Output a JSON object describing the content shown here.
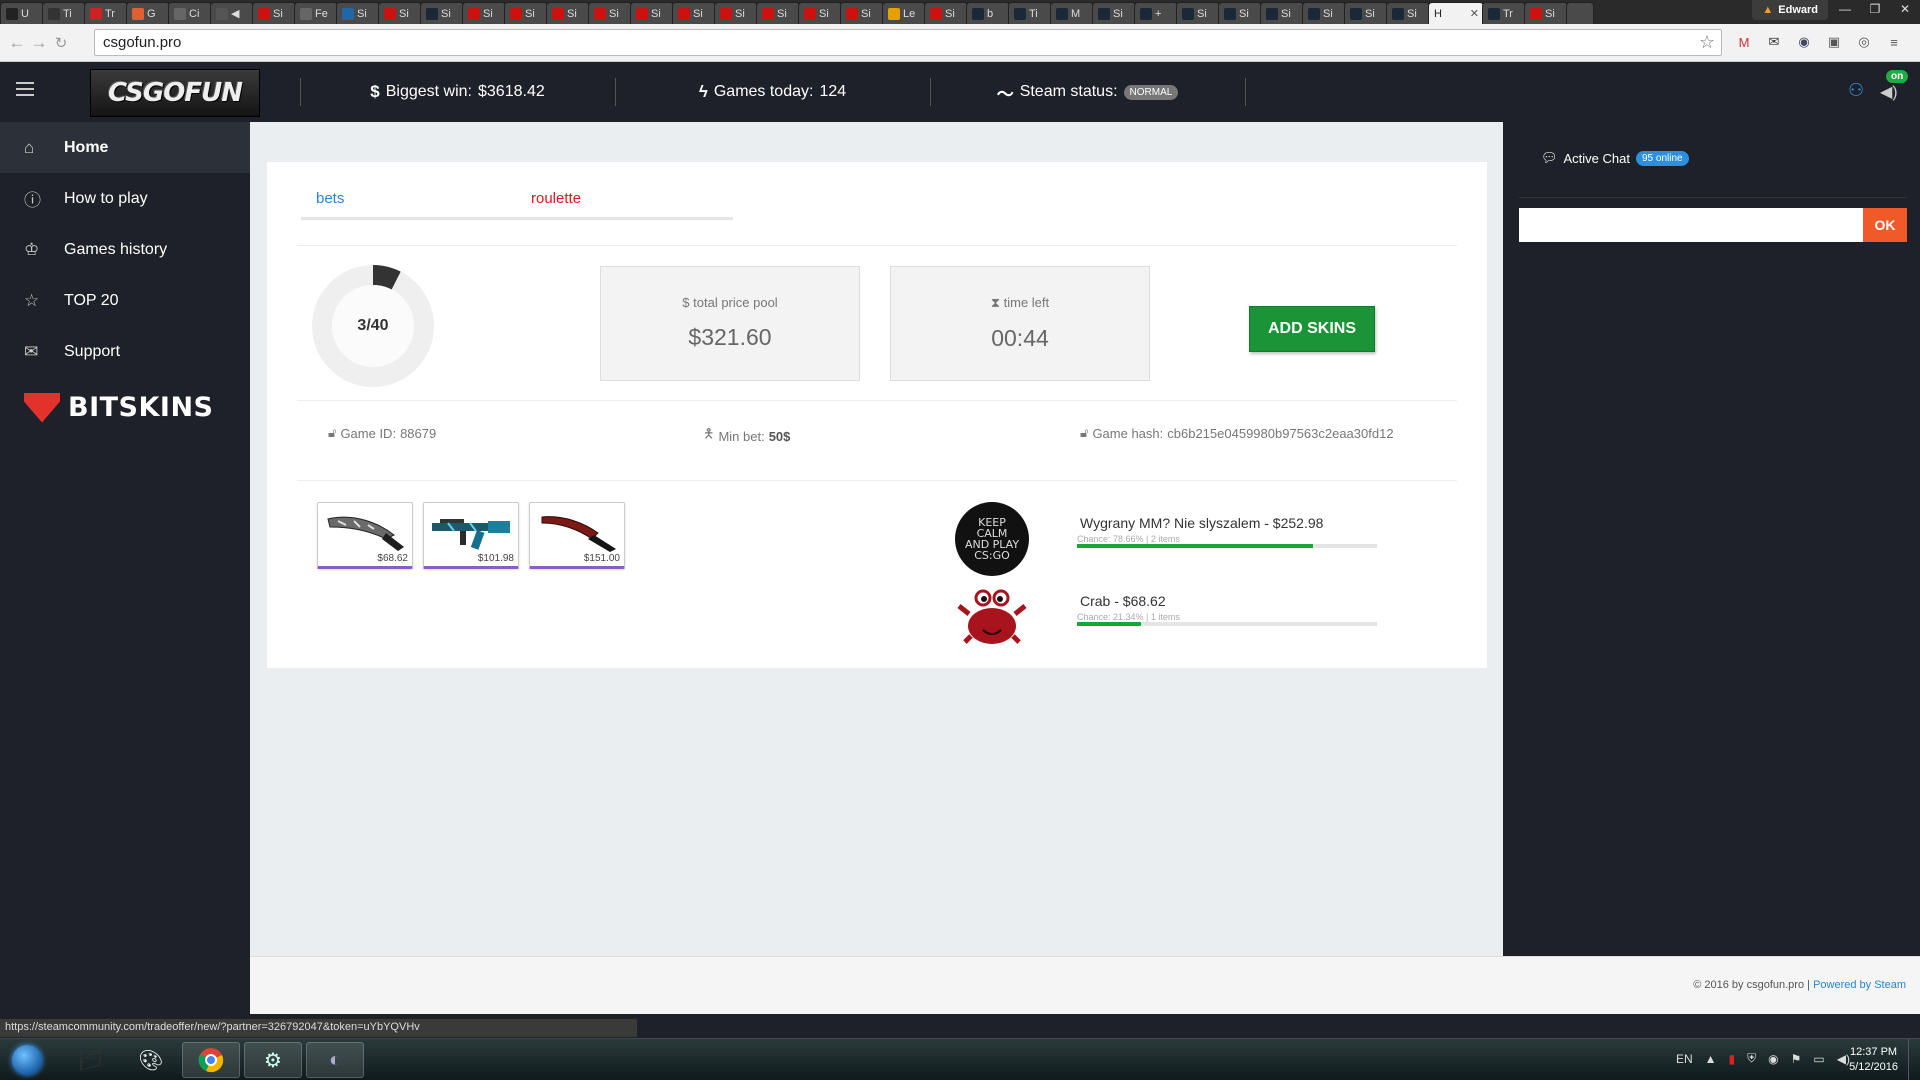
{
  "browser": {
    "tabs": [
      {
        "label": "U",
        "icon": "square-icon",
        "color": "#222"
      },
      {
        "label": "Ti",
        "icon": "circle-icon",
        "color": "#333"
      },
      {
        "label": "Tr",
        "icon": "youtube-icon",
        "color": "#cc2222"
      },
      {
        "label": "G",
        "icon": "g-icon",
        "color": "#e06030"
      },
      {
        "label": "Ci",
        "icon": "doc-icon",
        "color": "#666"
      },
      {
        "label": "◀",
        "icon": "audio-icon",
        "color": "#555"
      },
      {
        "label": "Si",
        "icon": "sr-icon",
        "color": "#cc1111"
      },
      {
        "label": "Fe",
        "icon": "doc-icon",
        "color": "#666"
      },
      {
        "label": "Si",
        "icon": "v-icon",
        "color": "#2266aa"
      },
      {
        "label": "Si",
        "icon": "sr-icon",
        "color": "#cc1111"
      },
      {
        "label": "Si",
        "icon": "steam-icon",
        "color": "#1b2838"
      },
      {
        "label": "Si",
        "icon": "sr-icon",
        "color": "#cc1111"
      },
      {
        "label": "Si",
        "icon": "sr-icon",
        "color": "#cc1111"
      },
      {
        "label": "Si",
        "icon": "sr-icon",
        "color": "#cc1111"
      },
      {
        "label": "Si",
        "icon": "sr-icon",
        "color": "#cc1111"
      },
      {
        "label": "Si",
        "icon": "sr-icon",
        "color": "#cc1111"
      },
      {
        "label": "Si",
        "icon": "sr-icon",
        "color": "#cc1111"
      },
      {
        "label": "Si",
        "icon": "sr-icon",
        "color": "#cc1111"
      },
      {
        "label": "Si",
        "icon": "sr-icon",
        "color": "#cc1111"
      },
      {
        "label": "Si",
        "icon": "sr-icon",
        "color": "#cc1111"
      },
      {
        "label": "Si",
        "icon": "sr-icon",
        "color": "#cc1111"
      },
      {
        "label": "Le",
        "icon": "coin-icon",
        "color": "#e8a000"
      },
      {
        "label": "Si",
        "icon": "sr-icon",
        "color": "#cc1111"
      },
      {
        "label": "b",
        "icon": "steam-icon",
        "color": "#1b2838"
      },
      {
        "label": "Ti",
        "icon": "steam-icon",
        "color": "#1b2838"
      },
      {
        "label": "M",
        "icon": "steam-icon",
        "color": "#1b2838"
      },
      {
        "label": "Si",
        "icon": "steam-icon",
        "color": "#1b2838"
      },
      {
        "label": "+",
        "icon": "steam-icon",
        "color": "#1b2838"
      },
      {
        "label": "Si",
        "icon": "steam-icon",
        "color": "#1b2838"
      },
      {
        "label": "Si",
        "icon": "steam-icon",
        "color": "#1b2838"
      },
      {
        "label": "Si",
        "icon": "steam-icon",
        "color": "#1b2838"
      },
      {
        "label": "Si",
        "icon": "steam-icon",
        "color": "#1b2838"
      },
      {
        "label": "Si",
        "icon": "steam-icon",
        "color": "#1b2838"
      },
      {
        "label": "Si",
        "icon": "steam-icon",
        "color": "#1b2838"
      }
    ],
    "active_tab": {
      "label": "H",
      "close": "✕"
    },
    "after_tabs": [
      {
        "label": "Tr",
        "icon": "steam-icon",
        "color": "#1b2838"
      },
      {
        "label": "Si",
        "icon": "sr-icon",
        "color": "#cc1111"
      }
    ],
    "user": "Edward",
    "window_controls": [
      "—",
      "❐",
      "✕"
    ],
    "url": "csgofun.pro",
    "status_url": "https://steamcommunity.com/tradeoffer/new/?partner=326792047&token=uYbYQVHv"
  },
  "header": {
    "logo": "CSGOFUN",
    "biggest_win_label": "Biggest win:",
    "biggest_win_value": "$3618.42",
    "games_today_label": "Games today:",
    "games_today_value": "124",
    "steam_status_label": "Steam status:",
    "steam_status_value": "NORMAL",
    "online_badge": "on"
  },
  "sidebar": {
    "items": [
      {
        "label": "Home",
        "icon": "home-icon",
        "glyph": "⌂"
      },
      {
        "label": "How to play",
        "icon": "info-icon",
        "glyph": "ⓘ"
      },
      {
        "label": "Games history",
        "icon": "trophy-icon",
        "glyph": "♔"
      },
      {
        "label": "TOP 20",
        "icon": "star-icon",
        "glyph": "☆"
      },
      {
        "label": "Support",
        "icon": "mail-icon",
        "glyph": "✉"
      }
    ],
    "sponsor": "BITSKINS"
  },
  "game": {
    "tabs": {
      "bets": "bets",
      "roulette": "roulette"
    },
    "items_count": "3/40",
    "items_fraction": 0.075,
    "total_pool_label": "total price pool",
    "total_pool_value": "$321.60",
    "time_left_label": "time left",
    "time_left_value": "00:44",
    "add_skins": "ADD SKINS",
    "game_id_label": "Game ID:",
    "game_id_value": "88679",
    "min_bet_label": "Min bet:",
    "min_bet_value": "50$",
    "game_hash_label": "Game hash:",
    "game_hash_value": "cb6b215e0459980b97563c2eaa30fd12",
    "skins": [
      {
        "price": "$68.62",
        "kind": "knife-camo"
      },
      {
        "price": "$101.98",
        "kind": "rifle-blue"
      },
      {
        "price": "$151.00",
        "kind": "knife-red"
      }
    ],
    "players": [
      {
        "name": "Wygrany MM? Nie slyszalem",
        "amount": "- $252.98",
        "chance_text": "Chance: 78.66% | 2 items",
        "chance": 0.7866,
        "avatar_text": "KEEP CALM AND PLAY CS:GO"
      },
      {
        "name": "Crab",
        "amount": "- $68.62",
        "chance_text": "Chance: 21.34% | 1 items",
        "chance": 0.2134
      }
    ]
  },
  "chat": {
    "title": "Active Chat",
    "online": "95 online",
    "input_value": "",
    "ok": "OK"
  },
  "footer": {
    "copyright": "© 2016 by csgofun.pro",
    "divider": "|",
    "powered": "Powered by Steam"
  },
  "taskbar": {
    "lang": "EN",
    "time": "12:37 PM",
    "date": "5/12/2016"
  },
  "colors": {
    "accent_blue": "#2a83d2",
    "accent_red": "#d9181e",
    "accent_green": "#1a9436",
    "chat_ok": "#f05a28",
    "sidebar_bg": "#1e2129"
  }
}
